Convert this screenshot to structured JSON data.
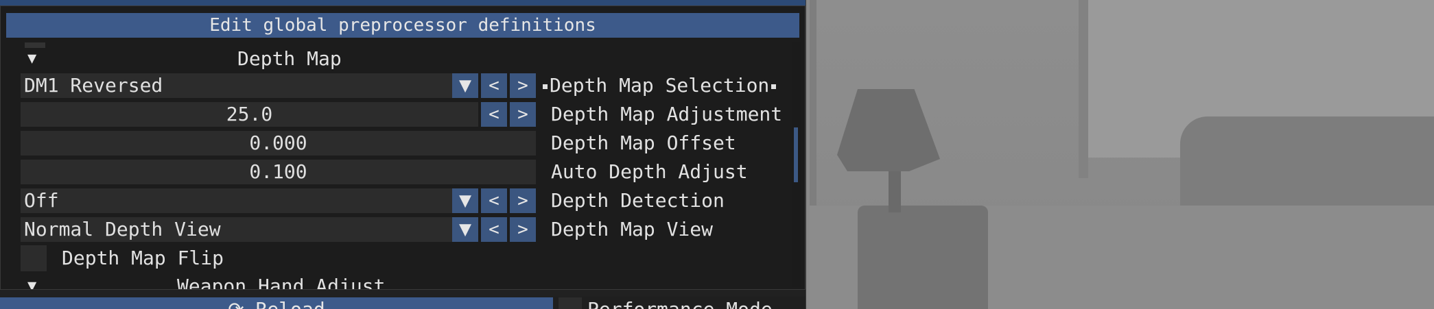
{
  "popup": {
    "title": "Edit global preprocessor definitions"
  },
  "section": {
    "toggle_glyph": "▼",
    "title": "Depth Map"
  },
  "rows": [
    {
      "value": "DM1 Reversed",
      "label": "Depth Map Selection",
      "combo": true,
      "marked": true
    },
    {
      "value": "25.0",
      "label": "Depth Map Adjustment",
      "combo": false
    },
    {
      "value": "0.000",
      "label": "Depth Map Offset"
    },
    {
      "value": "0.100",
      "label": "Auto Depth Adjust"
    },
    {
      "value": "Off",
      "label": "Depth Detection",
      "combo": true
    },
    {
      "value": "Normal Depth View",
      "label": "Depth Map View",
      "combo": true
    }
  ],
  "buttons": {
    "dropdown_glyph": "▼",
    "prev_glyph": "<",
    "next_glyph": ">"
  },
  "checkbox": {
    "label": "Depth Map Flip",
    "checked": false
  },
  "next_section": {
    "toggle_glyph": "▼",
    "title": "Weapon Hand Adjust"
  },
  "footer": {
    "reload_label": "Reload",
    "reload_icon": "refresh-icon",
    "performance_label": "Performance Mode",
    "performance_checked": false
  },
  "colors": {
    "accent": "#3d5a8a",
    "button": "#3b5680",
    "panel_bg": "#1c1c1c",
    "field_bg": "#2c2c2c",
    "text": "#e2e2e2"
  }
}
